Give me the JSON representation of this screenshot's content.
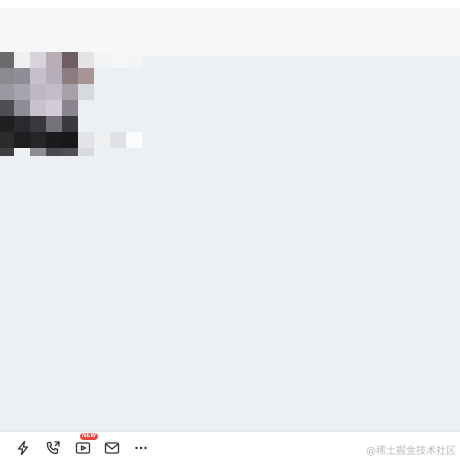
{
  "toolbar": {
    "tools": [
      {
        "icon": "lightning-icon"
      },
      {
        "icon": "phone-transfer-icon"
      },
      {
        "icon": "video-icon",
        "badge": "NEW"
      },
      {
        "icon": "mail-icon"
      },
      {
        "icon": "more-icon",
        "label": "···"
      }
    ]
  },
  "watermark": "@稀土掘金技术社区",
  "colors": {
    "header_bg": "#f7f7f8",
    "chat_bg": "#edf0f3",
    "badge": "#e8453c"
  }
}
